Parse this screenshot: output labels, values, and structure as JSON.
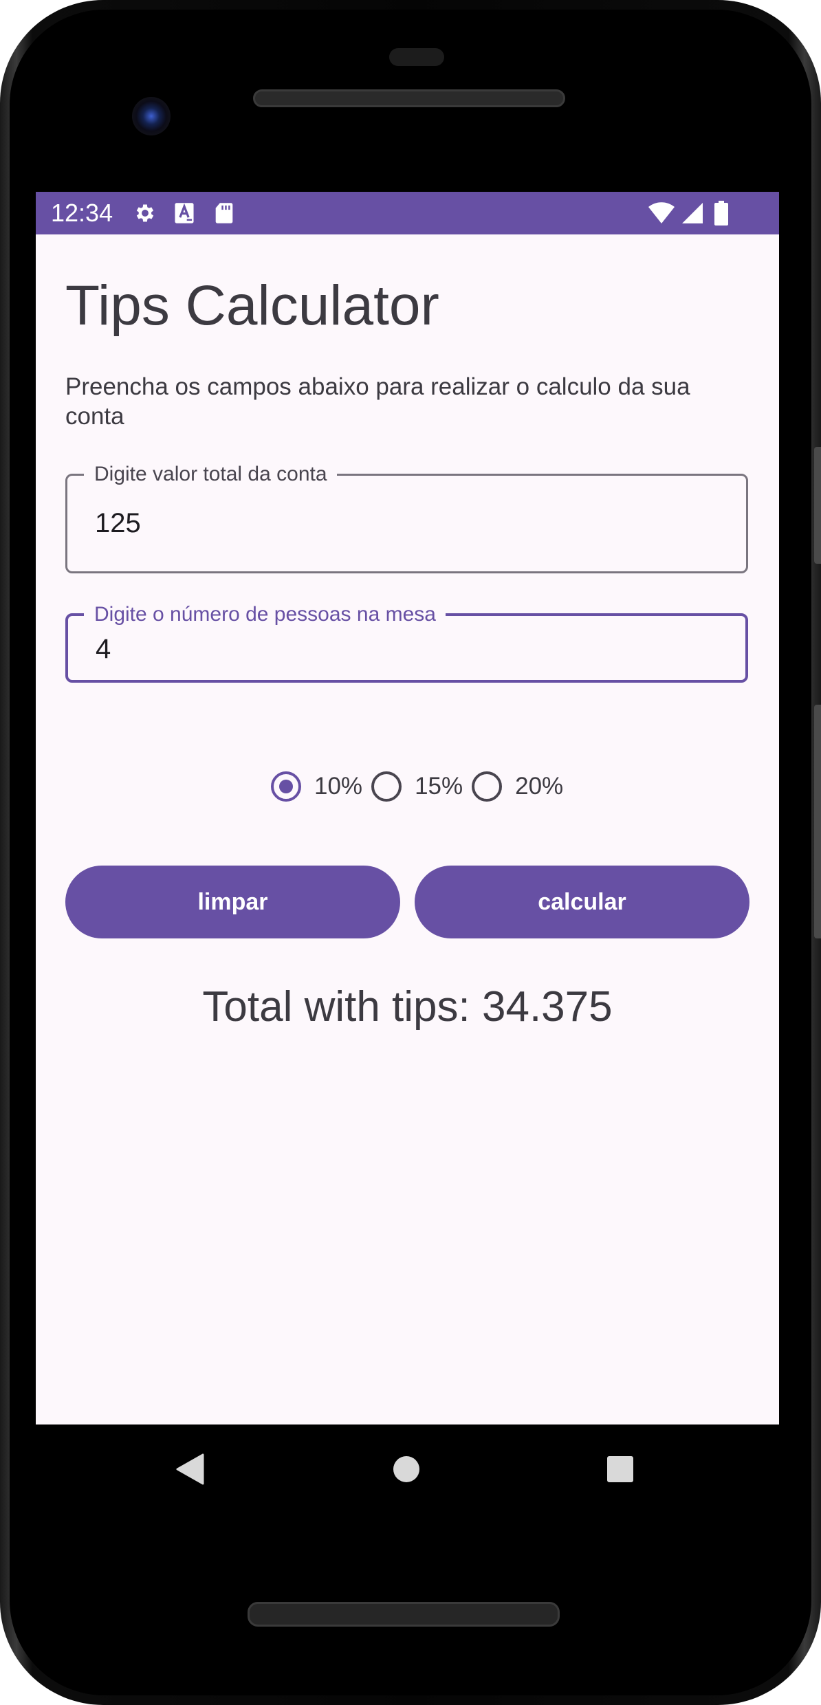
{
  "status_bar": {
    "time": "12:34",
    "left_icons": [
      "gear-icon",
      "a-keyboard-icon",
      "sd-card-icon"
    ],
    "right_icons": [
      "wifi-icon",
      "signal-icon",
      "battery-icon"
    ],
    "color": "#6750a4"
  },
  "app": {
    "title": "Tips Calculator",
    "description": "Preencha os campos abaixo para realizar o calculo da sua conta"
  },
  "fields": [
    {
      "label": "Digite valor total da conta",
      "value": "125",
      "focused": false
    },
    {
      "label": "Digite o número de pessoas na mesa",
      "value": "4",
      "focused": true
    }
  ],
  "tip_options": [
    {
      "label": "10%",
      "selected": true
    },
    {
      "label": "15%",
      "selected": false
    },
    {
      "label": "20%",
      "selected": false
    }
  ],
  "buttons": {
    "clear_label": "limpar",
    "calculate_label": "calcular"
  },
  "result": {
    "text": "Total with tips: 34.375"
  },
  "nav_bar": {
    "icons": [
      "back-icon",
      "home-icon",
      "recents-icon"
    ]
  },
  "colors": {
    "primary": "#6750a4",
    "background": "#fdf8fc",
    "text": "#3c3a41",
    "outline": "#7a757f"
  }
}
